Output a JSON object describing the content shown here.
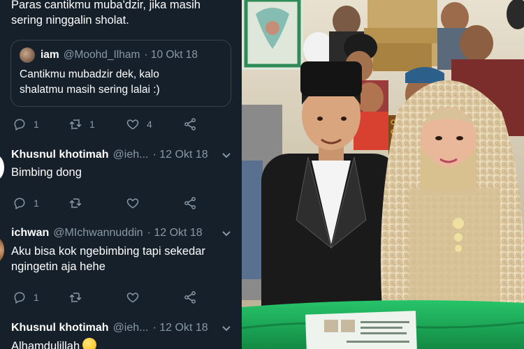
{
  "thread": {
    "top_tweet": {
      "text_line1": "Paras cantikmu muba'dzir, jika masih",
      "text_line2": "sering ninggalin sholat.",
      "quote": {
        "name": "iam",
        "handle": "@Moohd_Ilham",
        "date": "· 10 Okt 18",
        "text_line1": "Cantikmu mubadzir dek, kalo",
        "text_line2": "shalatmu masih sering lalai :)"
      },
      "actions": {
        "replies": "1",
        "retweets": "1",
        "likes": "4"
      }
    },
    "replies": [
      {
        "name": "Khusnul khotimah",
        "handle": "@ieh...",
        "date": "· 12 Okt 18",
        "text_line1": "Bimbing dong",
        "text_line2": "",
        "actions": {
          "replies": "1"
        }
      },
      {
        "name": "ichwan",
        "handle": "@MIchwannuddin",
        "date": "· 12 Okt 18",
        "text_line1": "Aku bisa kok ngebimbing tapi sekedar",
        "text_line2": "ngingetin aja hehe",
        "actions": {
          "replies": "1"
        }
      },
      {
        "name": "Khusnul khotimah",
        "handle": "@ieh...",
        "date": "· 12 Okt 18",
        "text_line1": "Alhamdulillah",
        "text_line2": ""
      }
    ]
  },
  "icons": {
    "reply": "reply-icon",
    "retweet": "retweet-icon",
    "like": "heart-icon",
    "share": "share-icon",
    "menu": "chevron-down-icon"
  },
  "colors": {
    "background": "#15202b",
    "muted_text": "#8899a6",
    "border": "#38444d",
    "primary_text": "#ffffff"
  }
}
